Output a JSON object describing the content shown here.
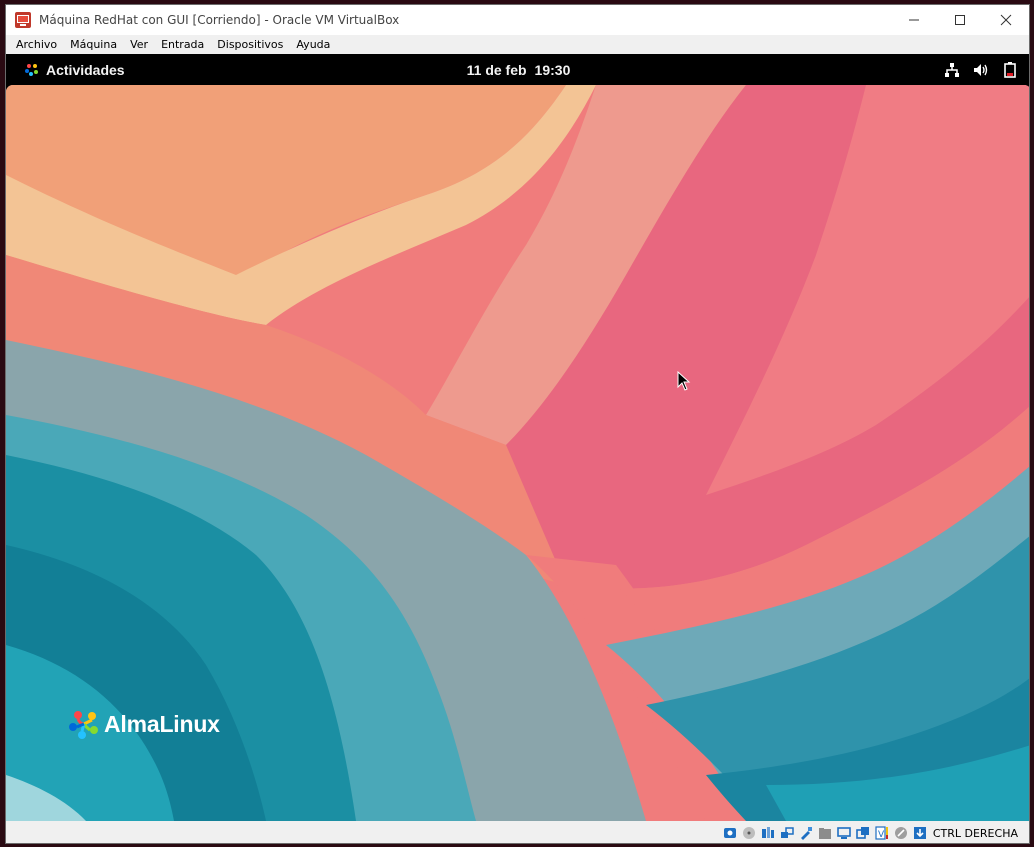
{
  "window": {
    "title": "Máquina RedHat con GUI [Corriendo] - Oracle VM VirtualBox",
    "controls": [
      "minimize-icon",
      "maximize-icon",
      "close-icon"
    ]
  },
  "menubar": {
    "items": [
      "Archivo",
      "Máquina",
      "Ver",
      "Entrada",
      "Dispositivos",
      "Ayuda"
    ]
  },
  "gnome": {
    "activities_label": "Actividades",
    "date": "11 de feb",
    "time": "19:30",
    "tray_icons": [
      "network-wired-icon",
      "volume-icon",
      "battery-icon"
    ]
  },
  "desktop": {
    "brand_name": "AlmaLinux",
    "wallpaper_colors": {
      "coral": "#f07c7c",
      "pink": "#e8677f",
      "peach": "#f1a78a",
      "sand": "#f3c495",
      "teal": "#1b8fa3",
      "slate": "#8aa5ab"
    }
  },
  "statusbar": {
    "icons": [
      "hard-disk-icon",
      "optical-drive-icon",
      "audio-icon",
      "network-icon",
      "usb-icon",
      "shared-folders-icon",
      "display-icon",
      "video-capture-icon",
      "virtualization-icon",
      "mouse-integration-icon",
      "keyboard-icon"
    ],
    "host_key_label": "CTRL DERECHA"
  },
  "colors": {
    "titlebar": "#ffffff",
    "menubar": "#f0f0f0",
    "topbar": "#000000",
    "accent_red": "#c62828"
  }
}
